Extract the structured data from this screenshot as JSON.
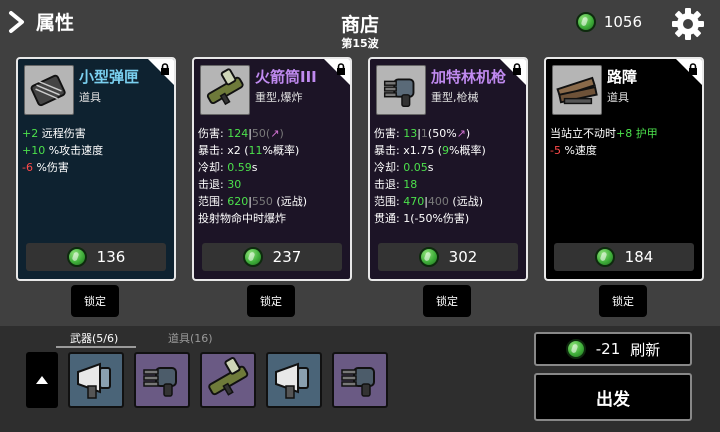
{
  "header": {
    "attributes_label": "属性",
    "title": "商店",
    "wave": "第15波",
    "money": "1056"
  },
  "cards": [
    {
      "name": "小型弹匣",
      "type": "道具",
      "icon": "ammo-magazine-icon",
      "price": "136",
      "lock_label": "锁定",
      "stats": [
        [
          {
            "t": "+2",
            "c": "g"
          },
          {
            "t": " 远程伤害"
          }
        ],
        [
          {
            "t": "+10",
            "c": "g"
          },
          {
            "t": " %攻击速度"
          }
        ],
        [
          {
            "t": "-6",
            "c": "r"
          },
          {
            "t": " %伤害"
          }
        ]
      ]
    },
    {
      "name": "火箭筒III",
      "type": "重型,爆炸",
      "icon": "rocket-launcher-icon",
      "price": "237",
      "lock_label": "锁定",
      "stats": [
        [
          {
            "t": "伤害: "
          },
          {
            "t": "124",
            "c": "g"
          },
          {
            "t": "|"
          },
          {
            "t": "50",
            "c": "d"
          },
          {
            "t": "(",
            "c": "d"
          },
          {
            "t": "↗",
            "c": "p"
          },
          {
            "t": ")",
            "c": "d"
          }
        ],
        [
          {
            "t": "暴击: x2 ("
          },
          {
            "t": "11",
            "c": "g"
          },
          {
            "t": "%概率)"
          }
        ],
        [
          {
            "t": "冷却: "
          },
          {
            "t": "0.59",
            "c": "g"
          },
          {
            "t": "s"
          }
        ],
        [
          {
            "t": "击退: "
          },
          {
            "t": "30",
            "c": "g"
          }
        ],
        [
          {
            "t": "范围: "
          },
          {
            "t": "620",
            "c": "g"
          },
          {
            "t": "|"
          },
          {
            "t": "550",
            "c": "d"
          },
          {
            "t": " (远战)"
          }
        ],
        [
          {
            "t": "投射物命中时爆炸"
          }
        ]
      ]
    },
    {
      "name": "加特林机枪",
      "type": "重型,枪械",
      "icon": "gatling-gun-icon",
      "price": "302",
      "lock_label": "锁定",
      "stats": [
        [
          {
            "t": "伤害: "
          },
          {
            "t": "13",
            "c": "g"
          },
          {
            "t": "|"
          },
          {
            "t": "1",
            "c": "d"
          },
          {
            "t": "(50%"
          },
          {
            "t": "↗",
            "c": "p"
          },
          {
            "t": ")"
          }
        ],
        [
          {
            "t": "暴击: x1.75 ("
          },
          {
            "t": "9",
            "c": "g"
          },
          {
            "t": "%概率)"
          }
        ],
        [
          {
            "t": "冷却: "
          },
          {
            "t": "0.05",
            "c": "g"
          },
          {
            "t": "s"
          }
        ],
        [
          {
            "t": "击退: "
          },
          {
            "t": "18",
            "c": "g"
          }
        ],
        [
          {
            "t": "范围: "
          },
          {
            "t": "470",
            "c": "g"
          },
          {
            "t": "|"
          },
          {
            "t": "400",
            "c": "d"
          },
          {
            "t": " (远战)"
          }
        ],
        [
          {
            "t": "贯通: 1(-50%伤害)"
          }
        ]
      ]
    },
    {
      "name": "路障",
      "type": "道具",
      "icon": "barricade-icon",
      "price": "184",
      "lock_label": "锁定",
      "stats": [
        [
          {
            "t": "当站立不动时"
          },
          {
            "t": "+8",
            "c": "g"
          },
          {
            "t": " "
          },
          {
            "t": "护甲",
            "c": "g"
          }
        ],
        [
          {
            "t": "-5",
            "c": "r"
          },
          {
            "t": " %速度"
          }
        ]
      ]
    }
  ],
  "inventory": {
    "tab_weapons": "武器(5/6)",
    "tab_items": "道具(16)",
    "slots": [
      {
        "icon": "megaphone-gun-icon",
        "style": "weapon-blue"
      },
      {
        "icon": "gatling-gun-icon",
        "style": "weapon-purple"
      },
      {
        "icon": "rocket-launcher-icon",
        "style": "weapon-purple"
      },
      {
        "icon": "megaphone-gun-icon",
        "style": "weapon-blue"
      },
      {
        "icon": "gatling-gun-icon",
        "style": "weapon-purple"
      }
    ]
  },
  "actions": {
    "refresh_cost": "-21",
    "refresh_label": "刷新",
    "go_label": "出发"
  }
}
